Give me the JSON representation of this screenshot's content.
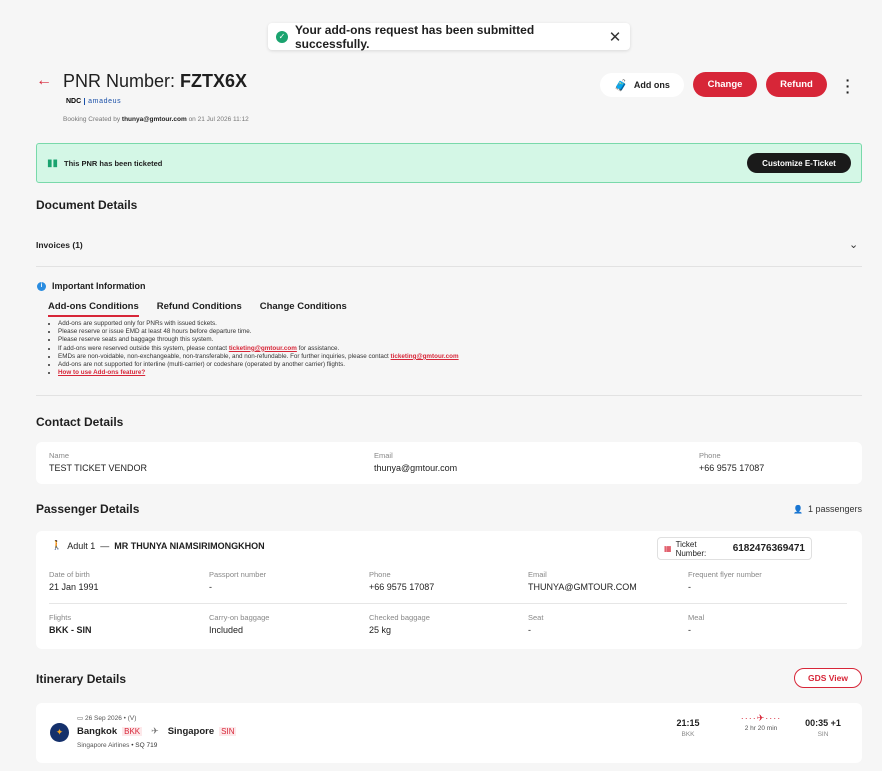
{
  "toast": {
    "message": "Your add-ons request has been submitted successfully.",
    "status_color": "#1aa36f"
  },
  "header": {
    "pnr_label": "PNR Number:",
    "pnr_value": "FZTX6X",
    "source_ndc": "NDC",
    "source_gds": "amadeus",
    "created_prefix": "Booking Created by",
    "created_by": "thunya@gmtour.com",
    "created_suffix": "on 21 Jul 2026 11:12",
    "actions": {
      "addons": "Add ons",
      "change": "Change",
      "refund": "Refund"
    },
    "accent_color": "#d72638"
  },
  "ticketed_banner": {
    "text": "This PNR has been ticketed",
    "button": "Customize E-Ticket"
  },
  "document": {
    "title": "Document Details",
    "invoices": "Invoices (1)"
  },
  "important": {
    "title": "Important Information",
    "tabs": [
      "Add-ons Conditions",
      "Refund Conditions",
      "Change Conditions"
    ],
    "active_tab": "Add-ons Conditions",
    "rules": [
      "Add-ons are supported only for PNRs with issued tickets.",
      "Please reserve or issue EMD at least 48 hours before departure time.",
      "Please reserve seats and baggage through this system."
    ],
    "rule_contact_pre": "If add-ons were reserved outside this system, please contact",
    "rule_contact_email": "ticketing@gmtour.com",
    "rule_contact_post": "for assistance.",
    "rule_emd_pre": "EMDs are non-voidable, non-exchangeable, non-transferable, and non-refundable. For further inquiries, please contact",
    "rule_emd_email": "ticketing@gmtour.com",
    "rule_interline": "Add-ons are not supported for interline (multi-carrier) or codeshare (operated by another carrier) flights.",
    "howto_link": "How to use Add-ons feature?"
  },
  "contact": {
    "title": "Contact Details",
    "name_label": "Name",
    "name": "TEST TICKET VENDOR",
    "email_label": "Email",
    "email": "thunya@gmtour.com",
    "phone_label": "Phone",
    "phone": "+66 9575 17087"
  },
  "passenger": {
    "title": "Passenger Details",
    "count": "1 passengers",
    "adult_label": "Adult 1",
    "name": "MR THUNYA NIAMSIRIMONGKHON",
    "ticket_label": "Ticket Number:",
    "ticket_number": "6182476369471",
    "dob_label": "Date of birth",
    "dob": "21 Jan 1991",
    "passport_label": "Passport number",
    "passport": "-",
    "phone_label": "Phone",
    "phone": "+66 9575 17087",
    "email_label": "Email",
    "email": "THUNYA@GMTOUR.COM",
    "ffn_label": "Frequent flyer number",
    "ffn": "-",
    "flights_label": "Flights",
    "flights": "BKK - SIN",
    "carryon_label": "Carry-on baggage",
    "carryon": "Included",
    "checked_label": "Checked baggage",
    "checked": "25 kg",
    "seat_label": "Seat",
    "seat": "-",
    "meal_label": "Meal",
    "meal": "-"
  },
  "itinerary": {
    "title": "Itinerary Details",
    "gds_button": "GDS View",
    "date": "26 Sep 2026 • (V)",
    "from_city": "Bangkok",
    "from_code": "BKK",
    "to_city": "Singapore",
    "to_code": "SIN",
    "airline": "Singapore Airlines",
    "flight_no": "• SQ 719",
    "dep_time": "21:15",
    "dep_airport": "BKK",
    "duration": "2 hr 20 min",
    "arr_time": "00:35 +1",
    "arr_airport": "SIN"
  }
}
